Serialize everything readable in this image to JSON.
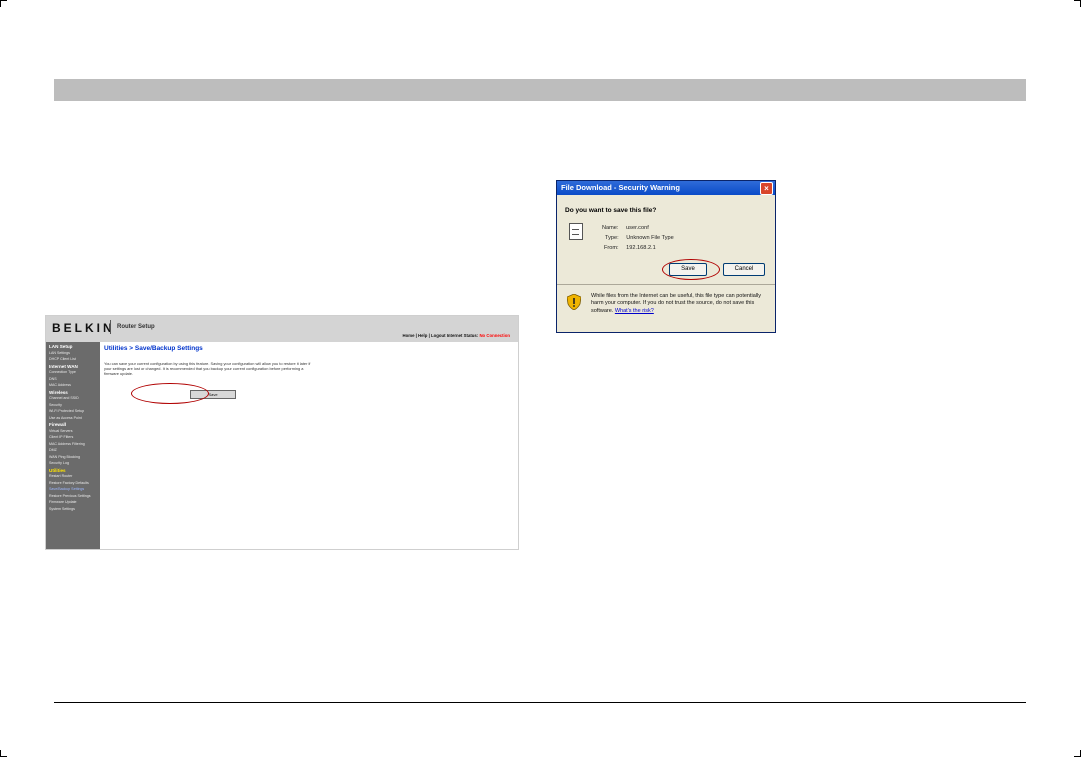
{
  "router": {
    "logo": "BELKIN",
    "setup_label": "Router Setup",
    "status_prefix": "Home | Help | Logout   Internet Status:",
    "status_value": "No Connection",
    "sidebar": [
      {
        "label": "LAN Setup",
        "heading": true
      },
      {
        "label": "LAN Settings"
      },
      {
        "label": "DHCP Client List"
      },
      {
        "label": "Internet WAN",
        "heading": true
      },
      {
        "label": "Connection Type"
      },
      {
        "label": "DNS"
      },
      {
        "label": "MAC Address"
      },
      {
        "label": "Wireless",
        "heading": true
      },
      {
        "label": "Channel and SSID"
      },
      {
        "label": "Security"
      },
      {
        "label": "Wi-Fi Protected Setup"
      },
      {
        "label": "Use as Access Point"
      },
      {
        "label": "Firewall",
        "heading": true
      },
      {
        "label": "Virtual Servers"
      },
      {
        "label": "Client IP Filters"
      },
      {
        "label": "MAC Address Filtering"
      },
      {
        "label": "DMZ"
      },
      {
        "label": "WAN Ping Blocking"
      },
      {
        "label": "Security Log"
      },
      {
        "label": "Utilities",
        "heading": true,
        "highlight": true
      },
      {
        "label": "Restart Router"
      },
      {
        "label": "Restore Factory Defaults"
      },
      {
        "label": "Save/Backup Settings",
        "active": true
      },
      {
        "label": "Restore Previous Settings"
      },
      {
        "label": "Firmware Update"
      },
      {
        "label": "System Settings"
      }
    ],
    "page_title": "Utilities > Save/Backup Settings",
    "description": "You can save your current configuration by using this feature. Saving your configuration will allow you to restore it later if your settings are lost or changed. It is recommended that you backup your current configuration before performing a firmware update.",
    "save_button": "Save"
  },
  "dialog": {
    "title": "File Download - Security Warning",
    "question": "Do you want to save this file?",
    "name_label": "Name:",
    "name_value": "user.conf",
    "type_label": "Type:",
    "type_value": "Unknown File Type",
    "from_label": "From:",
    "from_value": "192.168.2.1",
    "save_button": "Save",
    "cancel_button": "Cancel",
    "warning_text": "While files from the Internet can be useful, this file type can potentially harm your computer. If you do not trust the source, do not save this software.",
    "warning_link": "What's the risk?"
  }
}
